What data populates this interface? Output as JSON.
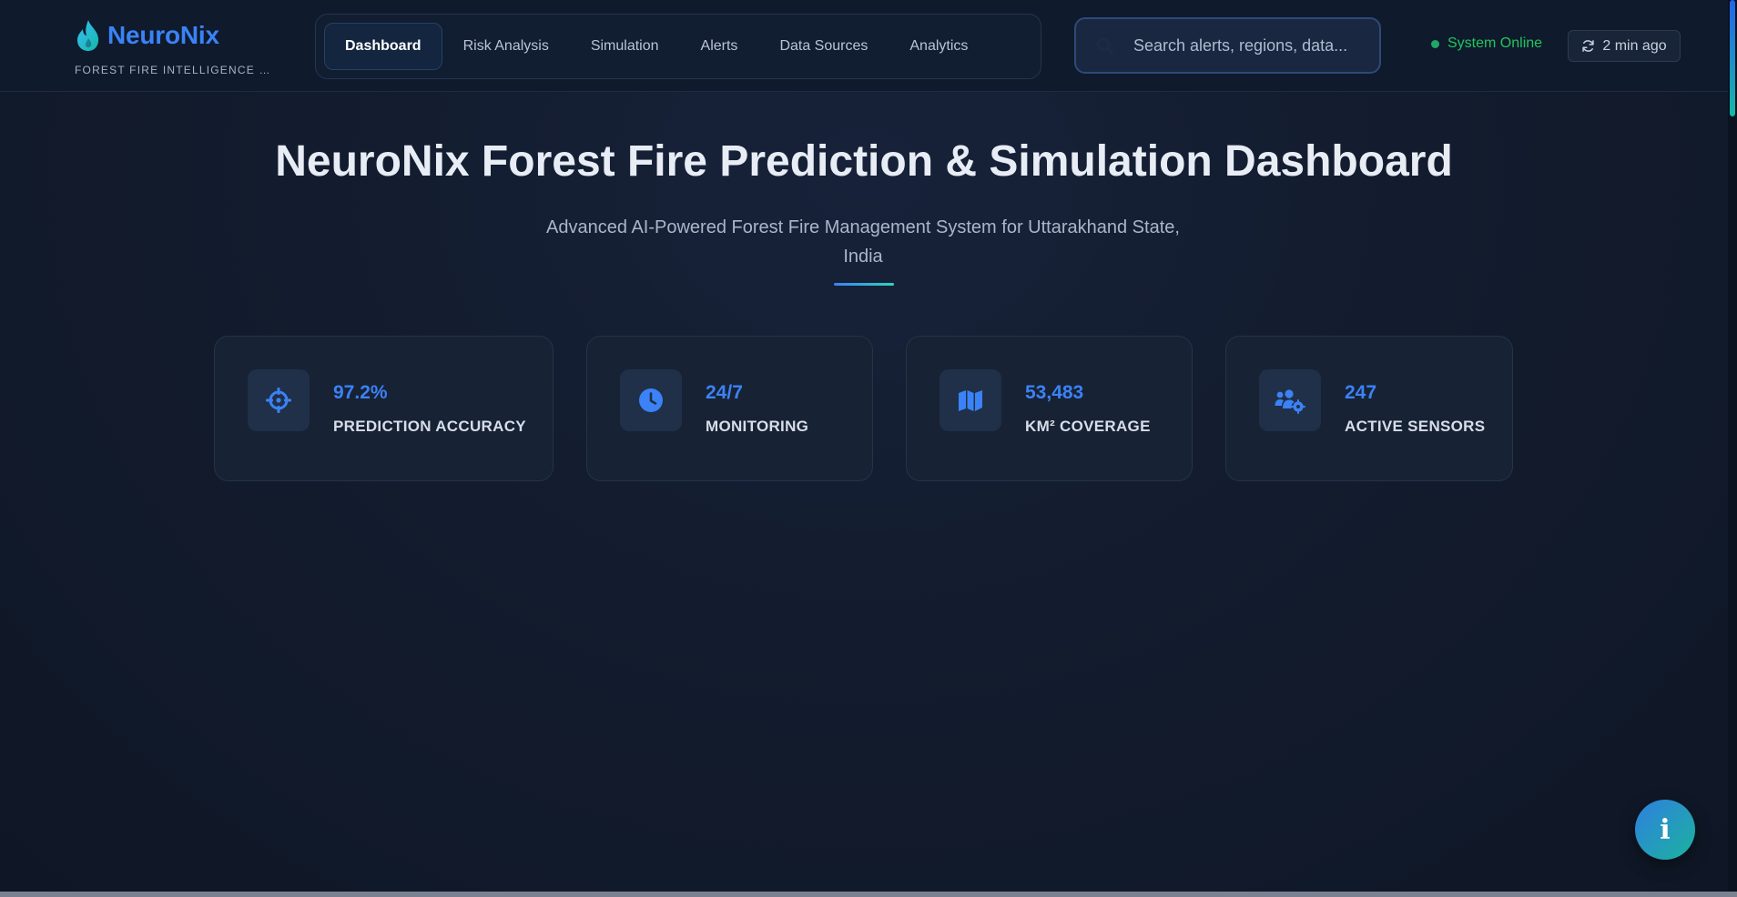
{
  "brand": {
    "name": "NeuroNix",
    "tagline": "FOREST FIRE INTELLIGENCE PLATFORM",
    "icon": "flame-icon"
  },
  "nav": {
    "items": [
      {
        "label": "Dashboard",
        "active": true
      },
      {
        "label": "Risk Analysis",
        "active": false
      },
      {
        "label": "Simulation",
        "active": false
      },
      {
        "label": "Alerts",
        "active": false
      },
      {
        "label": "Data Sources",
        "active": false
      },
      {
        "label": "Analytics",
        "active": false
      }
    ]
  },
  "search": {
    "placeholder": "Search alerts, regions, data...",
    "value": ""
  },
  "status": {
    "text": "System Online",
    "color": "#22c55e"
  },
  "refresh": {
    "label": "2 min ago",
    "icon": "refresh-icon"
  },
  "hero": {
    "title": "NeuroNix Forest Fire Prediction & Simulation Dashboard",
    "subtitle": "Advanced AI-Powered Forest Fire Management System for Uttarakhand State, India"
  },
  "stats": [
    {
      "value": "97.2%",
      "label": "PREDICTION ACCURACY",
      "icon": "crosshairs-icon"
    },
    {
      "value": "24/7",
      "label": "MONITORING",
      "icon": "clock-icon"
    },
    {
      "value": "53,483",
      "label": "KM² COVERAGE",
      "icon": "map-icon"
    },
    {
      "value": "247",
      "label": "ACTIVE SENSORS",
      "icon": "users-gear-icon"
    }
  ],
  "info_button": {
    "label": "i",
    "icon": "info-icon"
  },
  "colors": {
    "accent": "#3b82f6",
    "teal": "#2dd4bf",
    "background": "#111a2b",
    "online": "#22c55e"
  }
}
